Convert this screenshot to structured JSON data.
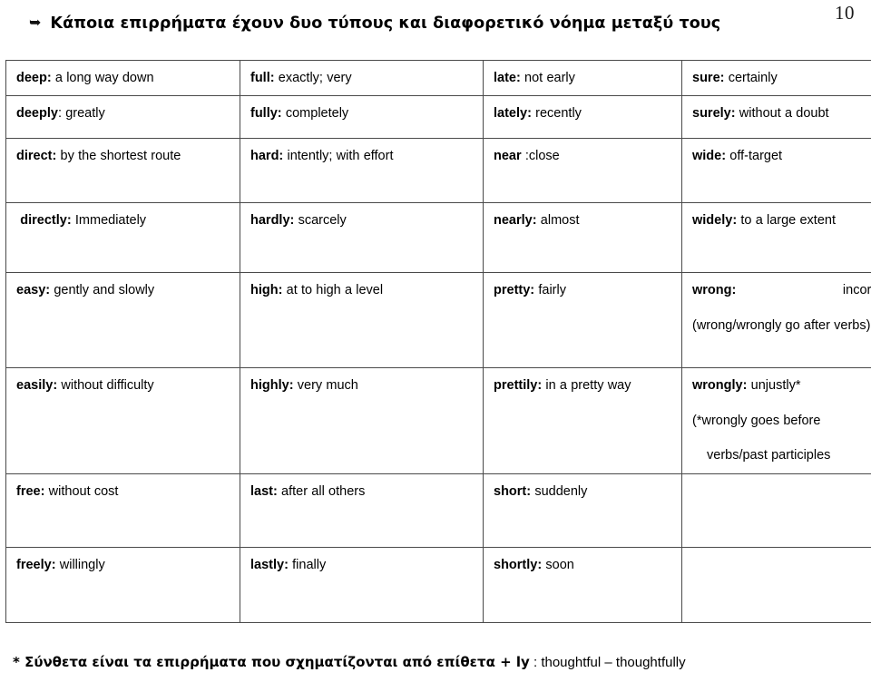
{
  "page": {
    "number": "10",
    "bullet_icon": "arrow-bullet-icon",
    "heading": "Κάποια επιρρήματα έχουν  δυο τύπους και διαφορετικό νόημα μεταξύ τους"
  },
  "table": {
    "rows": [
      [
        {
          "term": "deep:",
          "def": " a long way down"
        },
        {
          "term": "full:",
          "def": " exactly; very"
        },
        {
          "term": "late:",
          "def": " not early"
        },
        {
          "term": "sure:",
          "def": " certainly"
        }
      ],
      [
        {
          "term": "deeply",
          "def": ": greatly"
        },
        {
          "term": "fully:",
          "def": " completely"
        },
        {
          "term": "lately:",
          "def": " recently"
        },
        {
          "term": "surely:",
          "def": " without a doubt"
        }
      ],
      [
        {
          "term": "direct:",
          "def": " by the shortest route"
        },
        {
          "term": "hard:",
          "def": " intently; with effort"
        },
        {
          "term": "near",
          "def": " :close"
        },
        {
          "term": "wide:",
          "def": " off-target"
        }
      ],
      [
        {
          "term": "directly:",
          "def": " Immediately"
        },
        {
          "term": "hardly:",
          "def": " scarcely"
        },
        {
          "term": "nearly:",
          "def": " almost"
        },
        {
          "term": "widely:",
          "def": " to a large extent"
        }
      ],
      [
        {
          "term": "easy:",
          "def": " gently and slowly"
        },
        {
          "term": "high:",
          "def": " at to high a level"
        },
        {
          "term": "pretty:",
          "def": " fairly"
        },
        {
          "term": "wrong:",
          "def": " incorrectly",
          "note": "(wrong/wrongly go after verbs)"
        }
      ],
      [
        {
          "term": "easily:",
          "def": " without difficulty"
        },
        {
          "term": "highly:",
          "def": " very much"
        },
        {
          "term": "prettily:",
          "def": " in a pretty way"
        },
        {
          "term": "wrongly:",
          "def": " unjustly*",
          "note": "(*wrongly goes before",
          "note2": "verbs/past participles"
        }
      ],
      [
        {
          "term": "free:",
          "def": " without cost"
        },
        {
          "term": "last:",
          "def": " after all others"
        },
        {
          "term": "short:",
          "def": " suddenly"
        },
        {
          "term": "",
          "def": ""
        }
      ],
      [
        {
          "term": "freely:",
          "def": " willingly"
        },
        {
          "term": "lastly:",
          "def": " finally"
        },
        {
          "term": "shortly:",
          "def": " soon"
        },
        {
          "term": "",
          "def": ""
        }
      ]
    ]
  },
  "footnote": {
    "greek": "* Σύνθετα είναι τα επιρρήματα που σχηματίζονται από επίθετα + ly",
    "english": " : thoughtful – thoughtfully"
  }
}
